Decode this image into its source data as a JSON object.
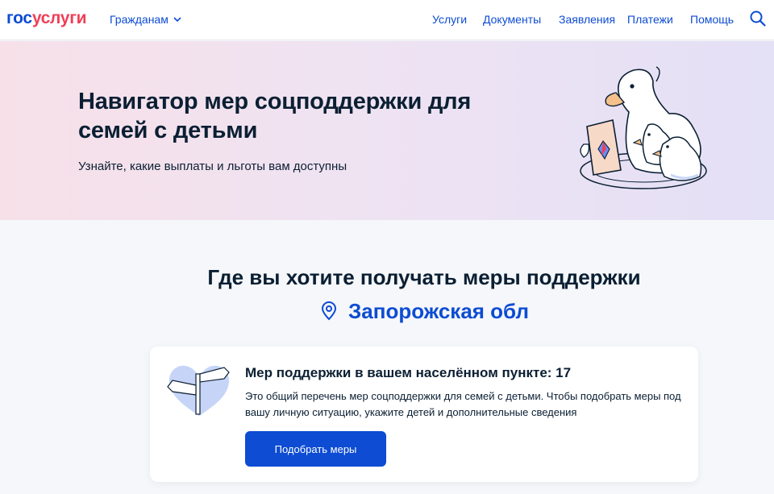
{
  "header": {
    "logo_part1": "гос",
    "logo_part2": "услуги",
    "citizens_label": "Гражданам",
    "nav": [
      "Услуги",
      "Документы",
      "Заявления",
      "Платежи",
      "Помощь"
    ]
  },
  "hero": {
    "title": "Навигатор мер соцподдержки для семей с детьми",
    "subtitle": "Узнайте, какие выплаты и льготы вам доступны"
  },
  "location": {
    "question": "Где вы хотите получать меры поддержки",
    "region": "Запорожская обл"
  },
  "card": {
    "title": "Мер поддержки в вашем населённом пункте: 17",
    "text": "Это общий перечень мер соцподдержки для семей с детьми. Чтобы подобрать меры под вашу личную ситуацию, укажите детей и дополнительные сведения",
    "button": "Подобрать меры"
  },
  "colors": {
    "brand_blue": "#0d4cd3",
    "brand_red": "#ee3f58",
    "text": "#0b1f33",
    "page_bg": "#f5f7fa"
  },
  "icons": [
    "chevron-down-icon",
    "search-icon",
    "location-pin-icon",
    "duck-family-illustration",
    "signpost-heart-illustration"
  ]
}
